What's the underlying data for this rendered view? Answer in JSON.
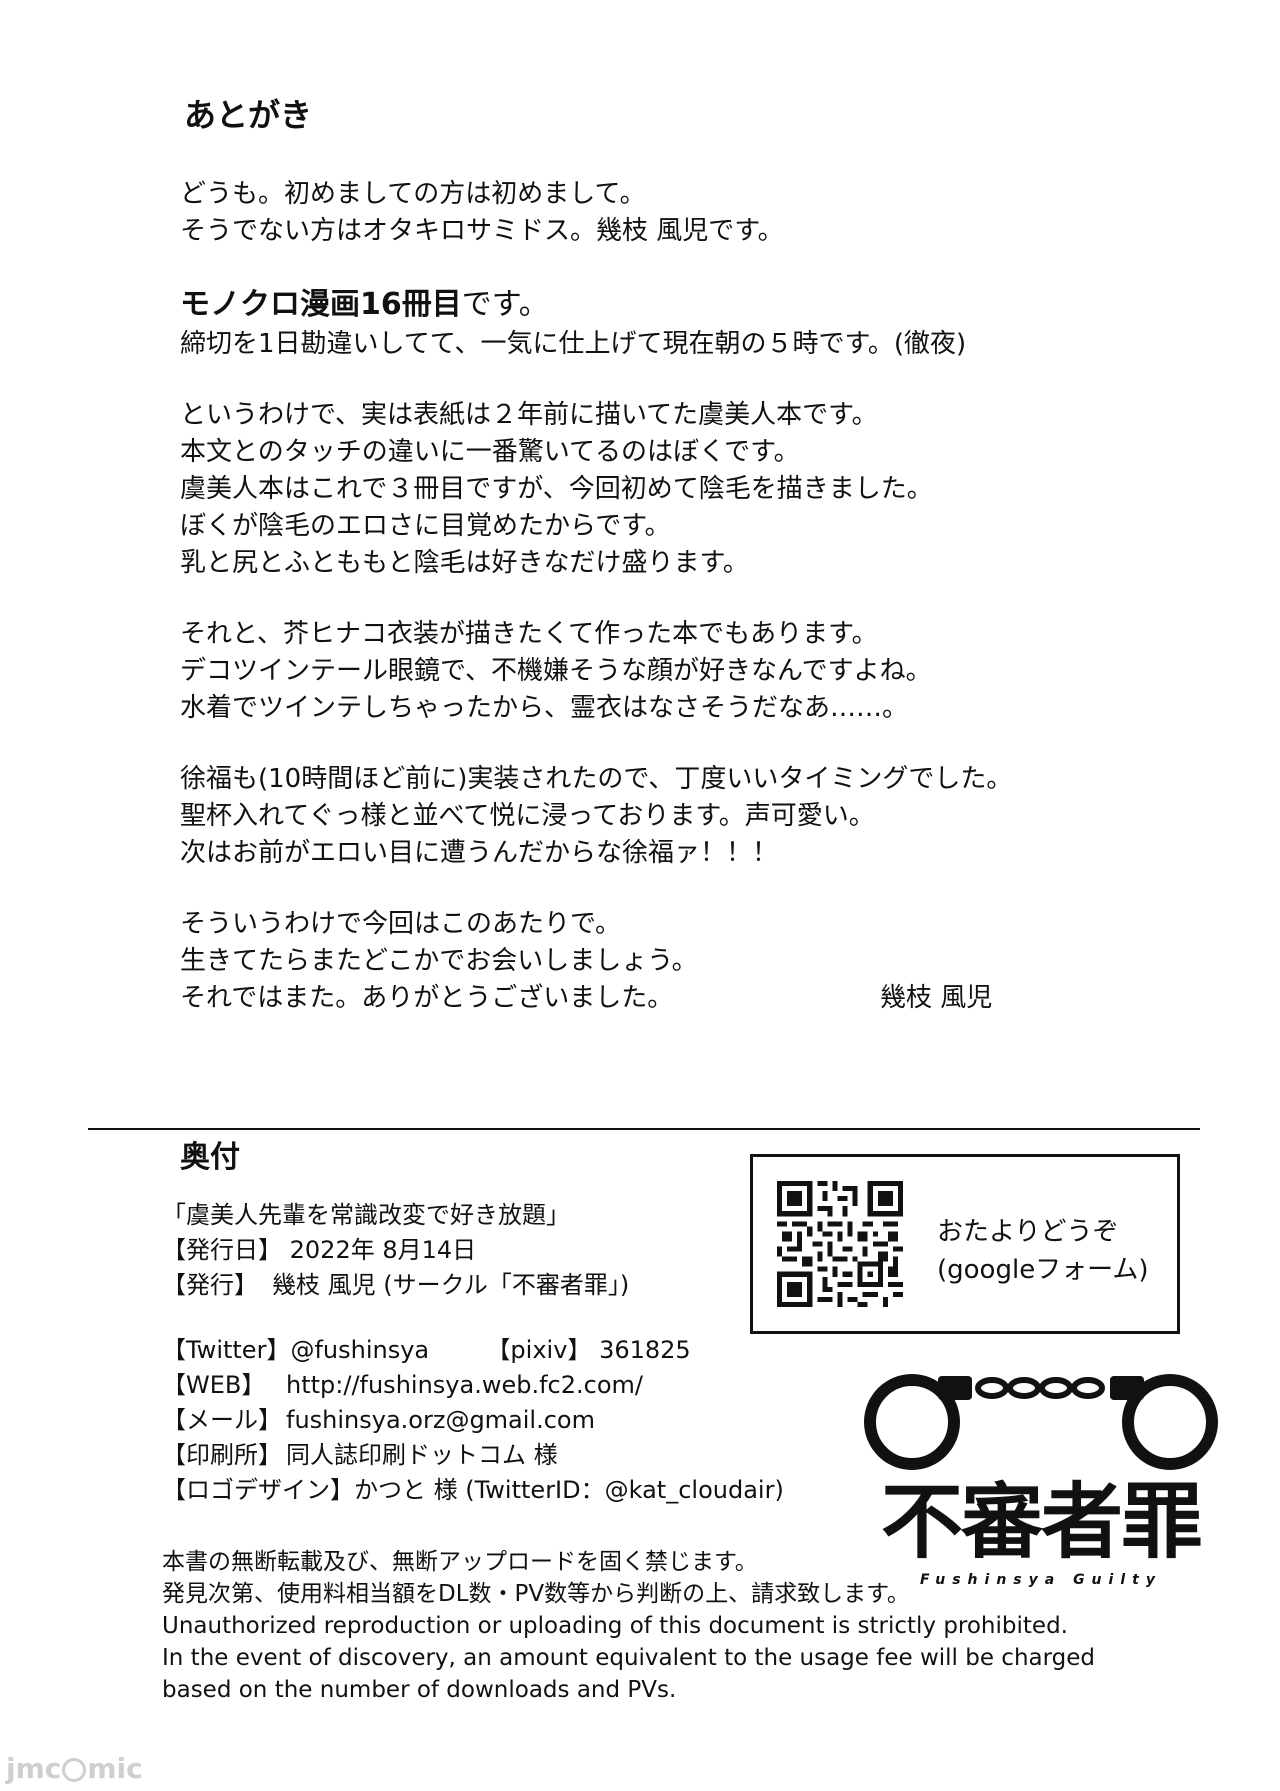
{
  "afterword": {
    "title": "あとがき",
    "p1": [
      "どうも。初めましての方は初めまして。",
      "そうでない方はオタキロサミドス。幾枝 風児です。"
    ],
    "p2_emph_strong": "モノクロ漫画16冊目",
    "p2_emph_rest": "です。",
    "p2_line2": "締切を1日勘違いしてて、一気に仕上げて現在朝の５時です。(徹夜)",
    "p3": [
      "というわけで、実は表紙は２年前に描いてた虞美人本です。",
      "本文とのタッチの違いに一番驚いてるのはぼくです。",
      "虞美人本はこれで３冊目ですが、今回初めて陰毛を描きました。",
      "ぼくが陰毛のエロさに目覚めたからです。",
      "乳と尻とふとももと陰毛は好きなだけ盛ります。"
    ],
    "p4": [
      "それと、芥ヒナコ衣装が描きたくて作った本でもあります。",
      "デコツインテール眼鏡で、不機嫌そうな顔が好きなんですよね。",
      "水着でツインテしちゃったから、霊衣はなさそうだなあ……。"
    ],
    "p5": [
      "徐福も(10時間ほど前に)実装されたので、丁度いいタイミングでした。",
      "聖杯入れてぐっ様と並べて悦に浸っております。声可愛い。",
      "次はお前がエロい目に遭うんだからな徐福ァ！！！"
    ],
    "p6": [
      "そういうわけで今回はこのあたりで。",
      "生きてたらまたどこかでお会いしましょう。",
      "それではまた。ありがとうございました。"
    ],
    "signature": "幾枝 風児"
  },
  "colophon": {
    "title": "奥付",
    "book_title": "「虞美人先輩を常識改変で好き放題」",
    "date_label": "【発行日】",
    "date_value": "2022年 8月14日",
    "publisher_label": "【発行】",
    "publisher_value": "幾枝 風児 (サークル「不審者罪」)",
    "twitter_label": "【Twitter】",
    "twitter_value": "@fushinsya",
    "pixiv_label": "【pixiv】",
    "pixiv_value": "361825",
    "web_label": "【WEB】",
    "web_value": "http://fushinsya.web.fc2.com/",
    "mail_label": "【メール】",
    "mail_value": "fushinsya.orz@gmail.com",
    "print_label": "【印刷所】",
    "print_value": "同人誌印刷ドットコム 様",
    "logo_label": "【ロゴデザイン】",
    "logo_value": "かつと 様 (TwitterID：@kat_cloudair)"
  },
  "contact": {
    "line1": "おたよりどうぞ",
    "line2": "(googleフォーム)"
  },
  "logo": {
    "kanji": "不審者罪",
    "sub": "Fushinsya Guilty"
  },
  "notice": {
    "jp1": "本書の無断転載及び、無断アップロードを固く禁じます。",
    "jp2": "発見次第、使用料相当額をDL数・PV数等から判断の上、請求致します。",
    "en1": "Unauthorized reproduction or uploading of this document is strictly prohibited.",
    "en2": "In the event of discovery, an amount equivalent to the usage fee will be charged",
    "en3": "based on the number of downloads and PVs."
  },
  "watermark": {
    "left": "jmc",
    "right": "mic"
  },
  "icons": {
    "qr": "qr-code-icon",
    "handcuffs": "handcuffs-icon"
  }
}
